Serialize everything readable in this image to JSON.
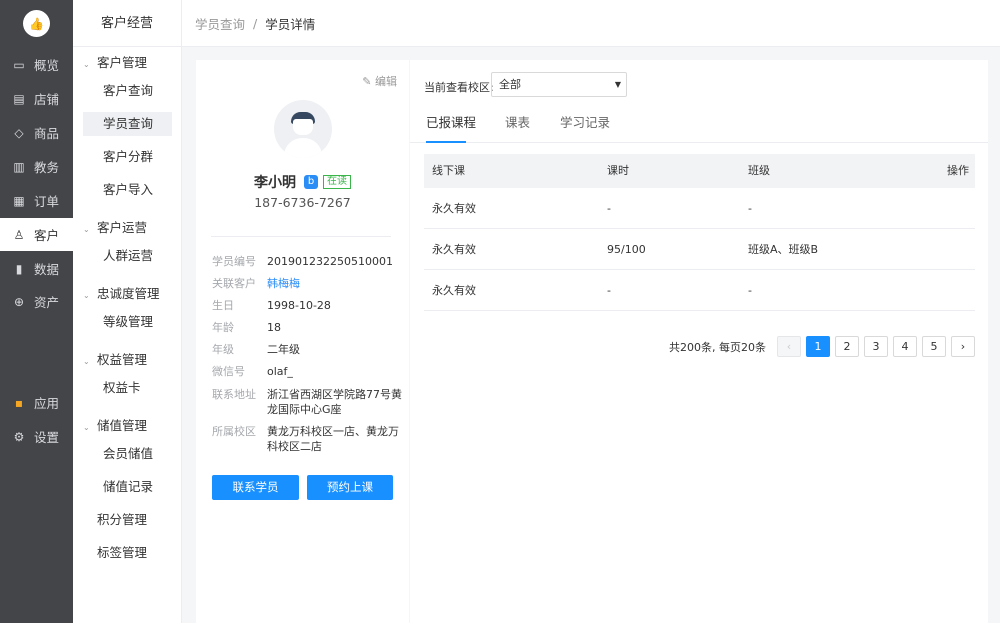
{
  "nav": {
    "logo_icon": "thumbs-up-icon",
    "items": [
      {
        "label": "概览",
        "icon": "monitor-icon",
        "glyph": "▭"
      },
      {
        "label": "店铺",
        "icon": "store-icon",
        "glyph": "▤"
      },
      {
        "label": "商品",
        "icon": "tag-icon",
        "glyph": "◇"
      },
      {
        "label": "教务",
        "icon": "building-icon",
        "glyph": "▥"
      },
      {
        "label": "订单",
        "icon": "list-icon",
        "glyph": "▦"
      },
      {
        "label": "客户",
        "icon": "user-icon",
        "glyph": "♙",
        "active": true
      },
      {
        "label": "数据",
        "icon": "bar-chart-icon",
        "glyph": "▮"
      },
      {
        "label": "资产",
        "icon": "coin-icon",
        "glyph": "⊕"
      }
    ],
    "bottom_items": [
      {
        "label": "应用",
        "icon": "apps-icon",
        "glyph": "▪"
      },
      {
        "label": "设置",
        "icon": "settings-icon",
        "glyph": "⚙"
      }
    ]
  },
  "subnav": {
    "title": "客户经营",
    "groups": [
      {
        "label": "客户管理",
        "items": [
          "客户查询",
          "学员查询",
          "客户分群",
          "客户导入"
        ]
      },
      {
        "label": "客户运营",
        "items": [
          "人群运营"
        ]
      },
      {
        "label": "忠诚度管理",
        "items": [
          "等级管理"
        ]
      },
      {
        "label": "权益管理",
        "items": [
          "权益卡"
        ]
      },
      {
        "label": "储值管理",
        "items": [
          "会员储值",
          "储值记录"
        ]
      }
    ],
    "plain_items": [
      "积分管理",
      "标签管理"
    ],
    "active_item": "学员查询"
  },
  "breadcrumb": {
    "parent": "学员查询",
    "separator": "/",
    "current": "学员详情"
  },
  "profile": {
    "edit_label": "编辑",
    "edit_glyph": "✎",
    "name": "李小明",
    "tag_glyph": "b",
    "status": "在读",
    "phone": "187-6736-7267",
    "fields": [
      {
        "key": "学员编号",
        "value": "2019012322505100​01"
      },
      {
        "key": "关联客户",
        "value": "韩梅梅",
        "link": true
      },
      {
        "key": "生日",
        "value": "1998-10-28"
      },
      {
        "key": "年龄",
        "value": "18"
      },
      {
        "key": "年级",
        "value": "二年级"
      },
      {
        "key": "微信号",
        "value": "olaf_"
      },
      {
        "key": "联系地址",
        "value": "浙江省西湖区学院路77号黄龙国际中心G座"
      },
      {
        "key": "所属校区",
        "value": "黄龙万科校区一店、黄龙万科校区二店"
      }
    ],
    "contact_button": "联系学员",
    "book_button": "预约上课"
  },
  "campus": {
    "label": "当前查看校区:",
    "value": "全部",
    "arrow": "▼"
  },
  "tabs": [
    "已报课程",
    "课表",
    "学习记录"
  ],
  "table": {
    "headers": [
      "线下课",
      "课时",
      "班级",
      "操作"
    ],
    "rows": [
      [
        "永久有效",
        "-",
        "-",
        ""
      ],
      [
        "永久有效",
        "95/100",
        "班级A、班级B",
        ""
      ],
      [
        "永久有效",
        "-",
        "-",
        ""
      ]
    ]
  },
  "pagination": {
    "summary": "共200条,  每页20条",
    "prev": "‹",
    "next": "›",
    "pages": [
      "1",
      "2",
      "3",
      "4",
      "5"
    ],
    "current": "1"
  }
}
